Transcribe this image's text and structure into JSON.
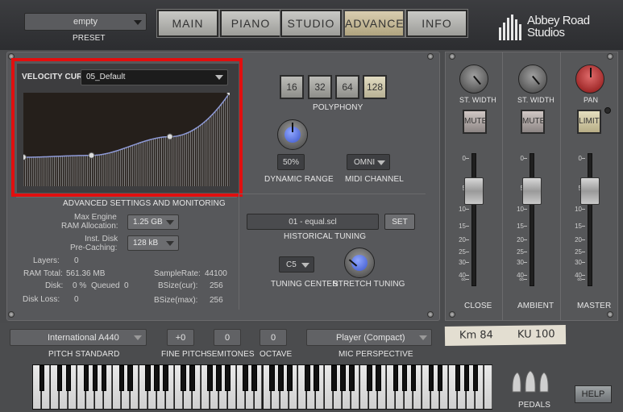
{
  "preset": {
    "value": "empty",
    "label": "PRESET"
  },
  "tabs": [
    {
      "label": "MAIN"
    },
    {
      "label": "PIANO"
    },
    {
      "label": "STUDIO"
    },
    {
      "label": "ADVANCED"
    },
    {
      "label": "INFO"
    }
  ],
  "logo": {
    "line1": "Abbey Road",
    "line2": "Studios"
  },
  "velocity": {
    "label": "VELOCITY CURVE",
    "value": "05_Default",
    "curve_points": [
      [
        0,
        0.31
      ],
      [
        0.33,
        0.33
      ],
      [
        0.71,
        0.53
      ],
      [
        1.0,
        1.0
      ]
    ]
  },
  "polyphony": {
    "label": "POLYPHONY",
    "options": [
      "16",
      "32",
      "64",
      "128"
    ],
    "selected": "128"
  },
  "dynamic_range": {
    "label": "DYNAMIC RANGE",
    "value": "50%"
  },
  "midi_channel": {
    "label": "MIDI CHANNEL",
    "value": "OMNI"
  },
  "advanced": {
    "title": "ADVANCED SETTINGS AND MONITORING",
    "max_engine_label_1": "Max Engine",
    "max_engine_label_2": "RAM Allocation:",
    "max_engine_value": "1.25 GB",
    "precache_label_1": "Inst. Disk",
    "precache_label_2": "Pre-Caching:",
    "precache_value": "128 kB",
    "layers_label": "Layers:",
    "layers_value": "0",
    "ram_label": "RAM Total:",
    "ram_value": "561.36 MB",
    "disk_label": "Disk:",
    "disk_value": "0 %",
    "queued_label": "Queued",
    "queued_value": "0",
    "diskloss_label": "Disk Loss:",
    "diskloss_value": "0",
    "samplerate_label": "SampleRate:",
    "samplerate_value": "44100",
    "bsizecur_label": "BSize(cur):",
    "bsizecur_value": "256",
    "bsizemax_label": "BSize(max):",
    "bsizemax_value": "256"
  },
  "tuning": {
    "file": "01 - equal.scl",
    "set_label": "SET",
    "label": "HISTORICAL TUNING",
    "center_value": "C5",
    "center_label": "TUNING CENTER",
    "stretch_label": "STRETCH TUNING"
  },
  "mixer": {
    "strips": [
      {
        "knob_label": "ST. WIDTH",
        "button": "MUTE",
        "name": "CLOSE"
      },
      {
        "knob_label": "ST. WIDTH",
        "button": "MUTE",
        "name": "AMBIENT"
      },
      {
        "knob_label": "PAN",
        "button": "LIMIT",
        "name": "MASTER"
      }
    ],
    "scale": [
      "0",
      "5",
      "10",
      "15",
      "20",
      "25",
      "30",
      "40",
      "∞"
    ],
    "fader_levels_db": [
      6,
      6,
      6
    ]
  },
  "bottom": {
    "pitch_standard_value": "International  A440",
    "pitch_standard_label": "PITCH STANDARD",
    "fine_pitch_value": "+0",
    "fine_pitch_label": "FINE PITCH",
    "semitones_value": "0",
    "semitones_label": "SEMITONES",
    "octave_value": "0",
    "octave_label": "OCTAVE",
    "mic_value": "Player (Compact)",
    "mic_label": "MIC PERSPECTIVE",
    "tape_1": "Km 84",
    "tape_2": "KU 100",
    "pedals_label": "PEDALS",
    "help_label": "HELP"
  },
  "colors": {
    "highlight": "#e10f0f",
    "active_tab": "#c6b98f",
    "graph_bg": "#251f1b"
  }
}
